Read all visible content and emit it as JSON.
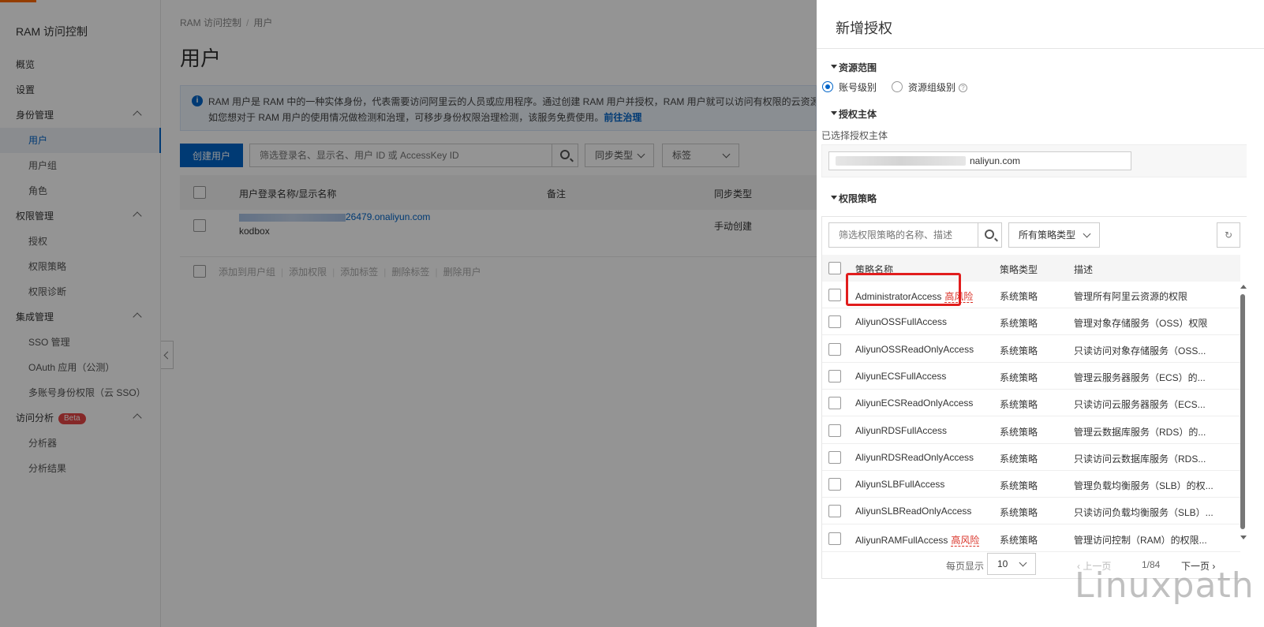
{
  "sidebar": {
    "title": "RAM 访问控制",
    "items": [
      {
        "label": "概览",
        "child": false,
        "expandable": false
      },
      {
        "label": "设置",
        "child": false,
        "expandable": false
      },
      {
        "label": "身份管理",
        "child": false,
        "expandable": true
      },
      {
        "label": "用户",
        "child": true,
        "active": true
      },
      {
        "label": "用户组",
        "child": true
      },
      {
        "label": "角色",
        "child": true
      },
      {
        "label": "权限管理",
        "child": false,
        "expandable": true
      },
      {
        "label": "授权",
        "child": true
      },
      {
        "label": "权限策略",
        "child": true
      },
      {
        "label": "权限诊断",
        "child": true
      },
      {
        "label": "集成管理",
        "child": false,
        "expandable": true
      },
      {
        "label": "SSO 管理",
        "child": true
      },
      {
        "label": "OAuth 应用（公测）",
        "child": true
      },
      {
        "label": "多账号身份权限（云 SSO）",
        "child": true
      },
      {
        "label": "访问分析",
        "child": false,
        "expandable": true,
        "badge": "Beta"
      },
      {
        "label": "分析器",
        "child": true
      },
      {
        "label": "分析结果",
        "child": true
      }
    ]
  },
  "main": {
    "breadcrumb": [
      "RAM 访问控制",
      "用户"
    ],
    "title": "用户",
    "info_line1": "RAM 用户是 RAM 中的一种实体身份，代表需要访问阿里云的人员或应用程序。通过创建 RAM 用户并授权，RAM 用户就可以访问有权限的云资源。",
    "info_line2": "如您想对于 RAM 用户的使用情况做检测和治理，可移步身份权限治理检测，该服务免费使用。",
    "info_link": "前往治理",
    "create_button": "创建用户",
    "search_placeholder": "筛选登录名、显示名、用户 ID 或 AccessKey ID",
    "filter_sync": "同步类型",
    "filter_tag": "标签",
    "columns": {
      "name": "用户登录名称/显示名称",
      "note": "备注",
      "sync": "同步类型"
    },
    "row": {
      "login_suffix": "26479.onaliyun.com",
      "display": "kodbox",
      "sync": "手动创建"
    },
    "bulk_actions": [
      "添加到用户组",
      "添加权限",
      "添加标签",
      "删除标签",
      "删除用户"
    ]
  },
  "drawer": {
    "title": "新增授权",
    "scope_title": "资源范围",
    "scope_options": [
      {
        "label": "账号级别",
        "checked": true
      },
      {
        "label": "资源组级别",
        "checked": false
      }
    ],
    "principal_title": "授权主体",
    "principal_label": "已选择授权主体",
    "principal_value_suffix": "naliyun.com",
    "policy_title": "权限策略",
    "policy_search_placeholder": "筛选权限策略的名称、描述",
    "policy_type_select": "所有策略类型",
    "columns": {
      "name": "策略名称",
      "type": "策略类型",
      "desc": "描述"
    },
    "risk_label": "高风险",
    "policies": [
      {
        "name": "AdministratorAccess",
        "risk": true,
        "type": "系统策略",
        "desc": "管理所有阿里云资源的权限"
      },
      {
        "name": "AliyunOSSFullAccess",
        "risk": false,
        "type": "系统策略",
        "desc": "管理对象存储服务（OSS）权限"
      },
      {
        "name": "AliyunOSSReadOnlyAccess",
        "risk": false,
        "type": "系统策略",
        "desc": "只读访问对象存储服务（OSS..."
      },
      {
        "name": "AliyunECSFullAccess",
        "risk": false,
        "type": "系统策略",
        "desc": "管理云服务器服务（ECS）的..."
      },
      {
        "name": "AliyunECSReadOnlyAccess",
        "risk": false,
        "type": "系统策略",
        "desc": "只读访问云服务器服务（ECS..."
      },
      {
        "name": "AliyunRDSFullAccess",
        "risk": false,
        "type": "系统策略",
        "desc": "管理云数据库服务（RDS）的..."
      },
      {
        "name": "AliyunRDSReadOnlyAccess",
        "risk": false,
        "type": "系统策略",
        "desc": "只读访问云数据库服务（RDS..."
      },
      {
        "name": "AliyunSLBFullAccess",
        "risk": false,
        "type": "系统策略",
        "desc": "管理负载均衡服务（SLB）的权..."
      },
      {
        "name": "AliyunSLBReadOnlyAccess",
        "risk": false,
        "type": "系统策略",
        "desc": "只读访问负载均衡服务（SLB）..."
      },
      {
        "name": "AliyunRAMFullAccess",
        "risk": true,
        "type": "系统策略",
        "desc": "管理访问控制（RAM）的权限..."
      }
    ],
    "pager": {
      "per_page_label": "每页显示",
      "per_page": "10",
      "prev": "上一页",
      "count": "1/84",
      "next": "下一页"
    }
  },
  "watermark": "Linuxpath"
}
